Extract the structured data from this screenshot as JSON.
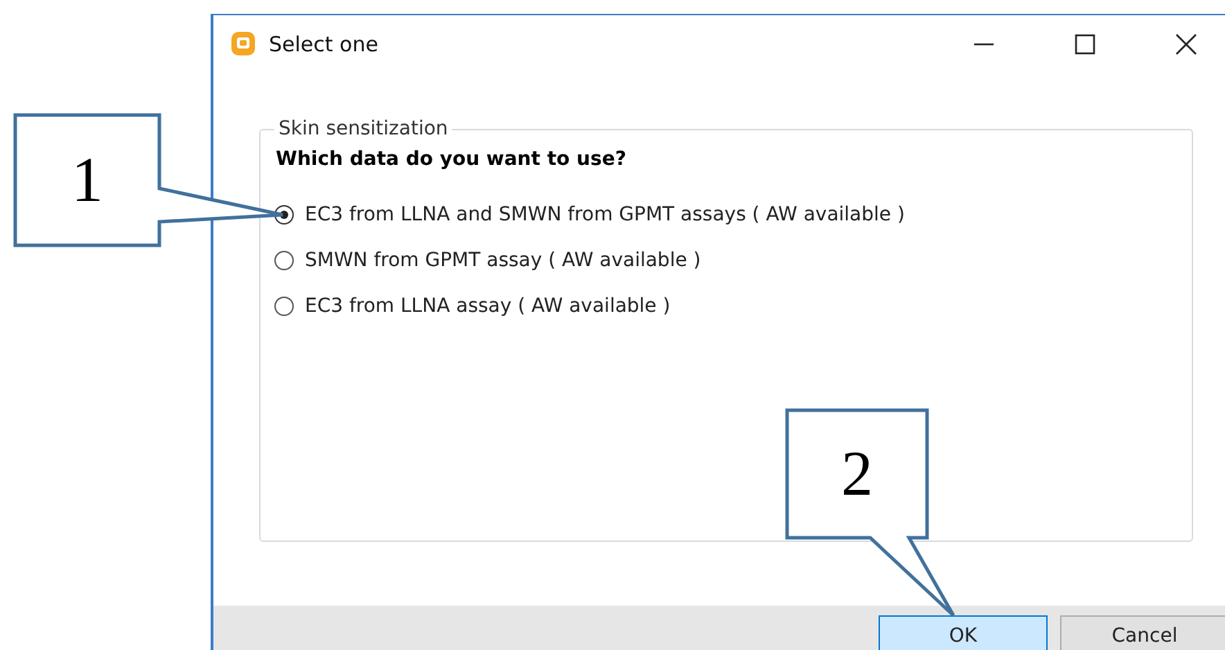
{
  "window": {
    "title": "Select one"
  },
  "group": {
    "title": "Skin sensitization",
    "question": "Which data do you want to use?",
    "options": [
      {
        "label": "EC3 from LLNA and SMWN from GPMT assays ( AW available )",
        "selected": true
      },
      {
        "label": "SMWN from GPMT assay ( AW available )",
        "selected": false
      },
      {
        "label": "EC3 from LLNA assay ( AW available )",
        "selected": false
      }
    ]
  },
  "buttons": [
    {
      "label": "OK",
      "kind": "default"
    },
    {
      "label": "Cancel",
      "kind": "normal"
    }
  ],
  "callouts": [
    {
      "label": "1"
    },
    {
      "label": "2"
    }
  ]
}
